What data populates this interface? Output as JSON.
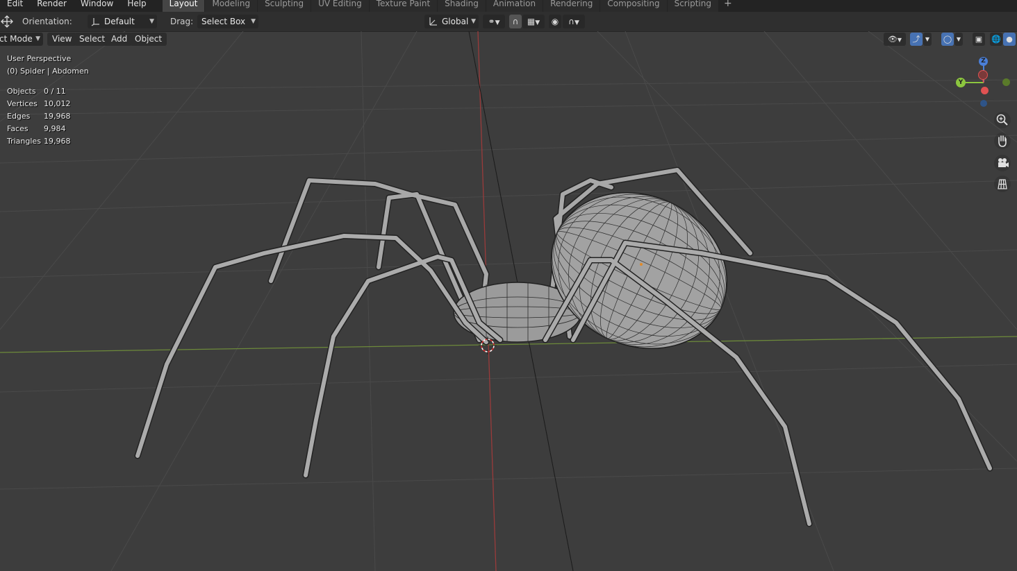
{
  "menu": [
    "Edit",
    "Render",
    "Window",
    "Help"
  ],
  "workspace_tabs": [
    "Layout",
    "Modeling",
    "Sculpting",
    "UV Editing",
    "Texture Paint",
    "Shading",
    "Animation",
    "Rendering",
    "Compositing",
    "Scripting"
  ],
  "active_tab": "Layout",
  "add_tab": "+",
  "toolbar": {
    "orientation_label": "Orientation:",
    "orientation_value": "Default",
    "drag_label": "Drag:",
    "drag_value": "Select Box",
    "transform_orientation": "Global"
  },
  "header": {
    "mode": "ct Mode",
    "view": "View",
    "select": "Select",
    "add": "Add",
    "object": "Object"
  },
  "viewport": {
    "perspective": "User Perspective",
    "active": "(0) Spider | Abdomen",
    "stats": [
      {
        "label": "Objects",
        "value": "0 / 11"
      },
      {
        "label": "Vertices",
        "value": "10,012"
      },
      {
        "label": "Edges",
        "value": "19,968"
      },
      {
        "label": "Faces",
        "value": "9,984"
      },
      {
        "label": "Triangles",
        "value": "19,968"
      }
    ]
  },
  "gizmo": {
    "z": "Z",
    "y": "Y"
  },
  "colors": {
    "x_axis": "#e05252",
    "y_axis": "#8cc63f",
    "z_axis": "#4a7fd8",
    "active_tab_bg": "#454545",
    "shading_active": "#4772b3"
  },
  "icons": {
    "zoom": "magnifier-icon",
    "pan": "hand-icon",
    "camera": "camera-icon",
    "ortho": "grid-icon"
  }
}
